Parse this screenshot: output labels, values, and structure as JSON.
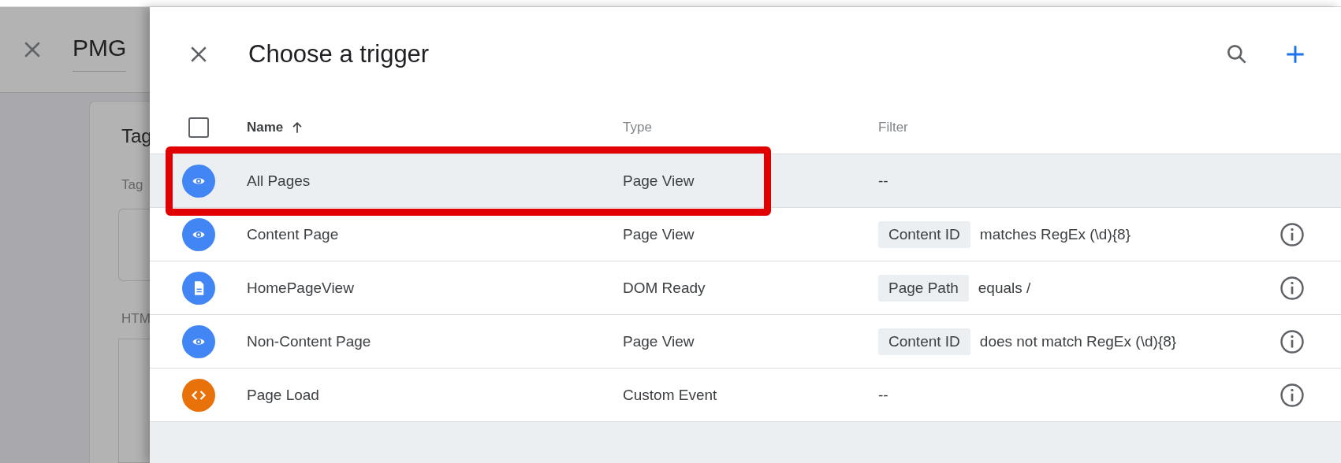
{
  "background": {
    "title": "PMG",
    "card_title": "Tag",
    "field_label": "Tag",
    "section_label": "HTM"
  },
  "panel": {
    "title": "Choose a trigger",
    "columns": [
      {
        "label": "Name",
        "sorted": true
      },
      {
        "label": "Type",
        "sorted": false
      },
      {
        "label": "Filter",
        "sorted": false
      }
    ],
    "select_all": {
      "checked": false
    },
    "rows": [
      {
        "kind": "eye",
        "color": "#4285f4",
        "name": "All Pages",
        "type": "Page View",
        "filter": {
          "text": "--"
        },
        "selected": true,
        "highlighted": true,
        "info": false
      },
      {
        "kind": "eye",
        "color": "#4285f4",
        "name": "Content Page",
        "type": "Page View",
        "filter": {
          "chip": "Content ID",
          "text": "matches RegEx (\\d){8}"
        },
        "selected": false,
        "highlighted": false,
        "info": true
      },
      {
        "kind": "document",
        "color": "#4285f4",
        "name": "HomePageView",
        "type": "DOM Ready",
        "filter": {
          "chip": "Page Path",
          "text": "equals /"
        },
        "selected": false,
        "highlighted": false,
        "info": true
      },
      {
        "kind": "eye",
        "color": "#4285f4",
        "name": "Non-Content Page",
        "type": "Page View",
        "filter": {
          "chip": "Content ID",
          "text": "does not match RegEx (\\d){8}"
        },
        "selected": false,
        "highlighted": false,
        "info": true
      },
      {
        "kind": "code",
        "color": "#e8710a",
        "name": "Page Load",
        "type": "Custom Event",
        "filter": {
          "text": "--"
        },
        "selected": false,
        "highlighted": false,
        "info": true
      }
    ]
  }
}
